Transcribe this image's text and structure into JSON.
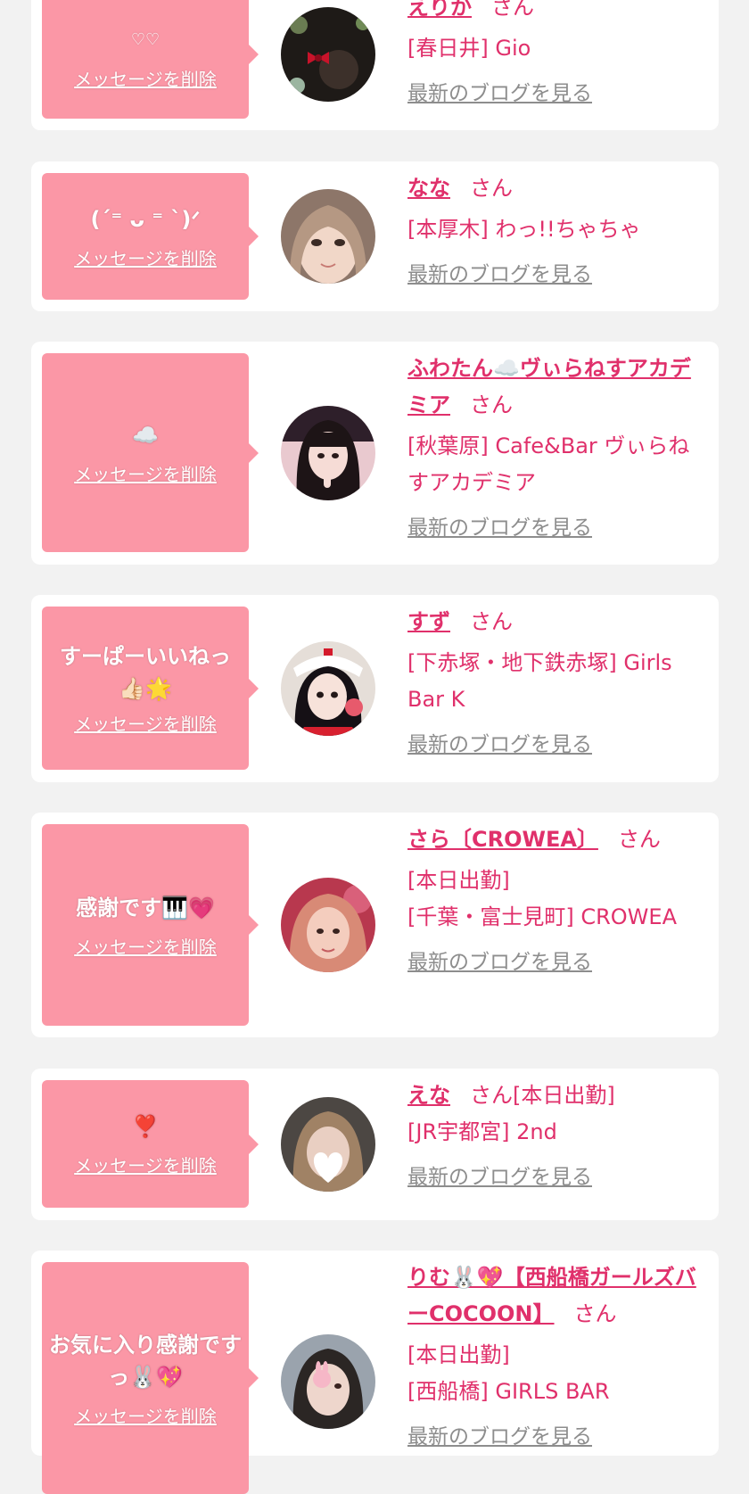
{
  "entries": [
    {
      "message": "♡♡",
      "delete_label": "メッセージを削除",
      "name": "えりか",
      "san": "さん",
      "shop_lines": [
        "[春日井] Gio"
      ],
      "blog_label": "最新のブログを見る"
    },
    {
      "message": "(ˊ⁼ ᴗ ⁼ ˋ)ᐟ",
      "delete_label": "メッセージを削除",
      "name": "なな",
      "san": "さん",
      "shop_lines": [
        "[本厚木] わっ!!ちゃちゃ"
      ],
      "blog_label": "最新のブログを見る"
    },
    {
      "message": "☁️",
      "delete_label": "メッセージを削除",
      "name": "ふわたん☁️ヴぃらねすアカデミア",
      "san": "さん",
      "shop_lines": [
        "[秋葉原] Cafe&Bar ヴぃらねすアカデミア"
      ],
      "blog_label": "最新のブログを見る"
    },
    {
      "message": "すーぱーいいねっ👍🏻🌟",
      "delete_label": "メッセージを削除",
      "name": "すず",
      "san": "さん",
      "shop_lines": [
        "[下赤塚・地下鉄赤塚] Girls Bar K"
      ],
      "blog_label": "最新のブログを見る"
    },
    {
      "message": "感謝です🎹💗",
      "delete_label": "メッセージを削除",
      "name": "さら〔CROWEA〕",
      "san": "さん",
      "shop_lines": [
        "[本日出勤]",
        "[千葉・富士見町] CROWEA"
      ],
      "blog_label": "最新のブログを見る"
    },
    {
      "message": "❣️",
      "delete_label": "メッセージを削除",
      "name": "えな",
      "san": "さん",
      "inline_after": "[本日出勤]",
      "shop_lines": [
        "[JR宇都宮] 2nd"
      ],
      "blog_label": "最新のブログを見る"
    },
    {
      "message": "お気に入り感謝ですっ🐰💖",
      "delete_label": "メッセージを削除",
      "name": "りむ🐰💖【西船橋ガールズバーCOCOON】",
      "san": "さん",
      "shop_lines": [
        "[本日出勤]",
        "[西船橋] GIRLS BAR"
      ],
      "blog_label": "最新のブログを見る"
    }
  ]
}
